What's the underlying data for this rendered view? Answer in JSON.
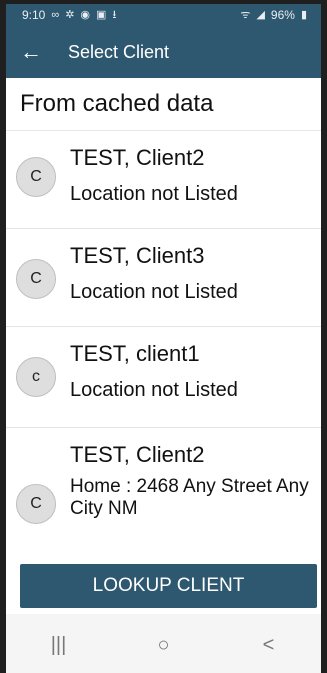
{
  "status_bar": {
    "time": "9:10",
    "icons_left": [
      "infinity-icon",
      "brightness-icon",
      "data-saver-icon",
      "image-icon",
      "download-icon"
    ],
    "battery": "96%"
  },
  "app_bar": {
    "title": "Select Client",
    "back_icon": "arrow-left-icon"
  },
  "section_header": "From cached data",
  "clients": [
    {
      "avatar": "C",
      "name": "TEST, Client2",
      "location": "Location not Listed"
    },
    {
      "avatar": "C",
      "name": "TEST, Client3",
      "location": "Location not Listed"
    },
    {
      "avatar": "c",
      "name": "TEST, client1",
      "location": "Location not Listed"
    },
    {
      "avatar": "C",
      "name": "TEST, Client2",
      "location": "Home : 2468 Any Street Any City NM"
    }
  ],
  "lookup_button": "LOOKUP CLIENT",
  "nav_bar": {
    "recents": "|||",
    "home": "○",
    "back": "<"
  },
  "colors": {
    "primary": "#2e5770",
    "avatar_bg": "#dedede"
  }
}
